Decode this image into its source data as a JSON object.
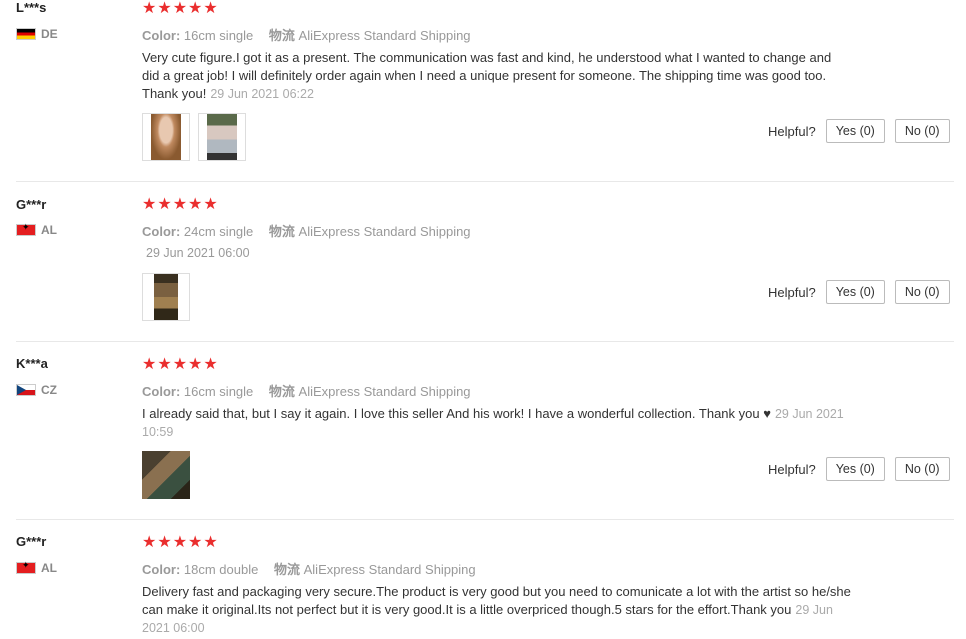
{
  "reviews": [
    {
      "user": "L***s",
      "country": "DE",
      "color_label": "Color:",
      "color_value": "16cm single",
      "ship_label": "物流",
      "ship_value": "AliExpress Standard Shipping",
      "text": "Very cute figure.I got it as a present. The communication was fast and kind, he understood what I wanted to change and did a great job! I will definitely order again when I need a unique present for someone. The shipping time was good too. Thank you!",
      "date": "29 Jun 2021 06:22",
      "rating": 5,
      "images": [
        "figure-photo",
        "figure-photo"
      ],
      "helpful_label": "Helpful?",
      "yes_label": "Yes (0)",
      "no_label": "No (0)"
    },
    {
      "user": "G***r",
      "country": "AL",
      "color_label": "Color:",
      "color_value": "24cm single",
      "ship_label": "物流",
      "ship_value": "AliExpress Standard Shipping",
      "text": "",
      "date": "29 Jun 2021 06:00",
      "rating": 5,
      "images": [
        "figure-photo"
      ],
      "helpful_label": "Helpful?",
      "yes_label": "Yes (0)",
      "no_label": "No (0)"
    },
    {
      "user": "K***a",
      "country": "CZ",
      "color_label": "Color:",
      "color_value": "16cm single",
      "ship_label": "物流",
      "ship_value": "AliExpress Standard Shipping",
      "text": "I already said that, but I say it again. I love this seller And his work! I have a wonderful collection. Thank you ♥",
      "date": "29 Jun 2021 10:59",
      "rating": 5,
      "images": [
        "collection-photo"
      ],
      "helpful_label": "Helpful?",
      "yes_label": "Yes (0)",
      "no_label": "No (0)"
    },
    {
      "user": "G***r",
      "country": "AL",
      "color_label": "Color:",
      "color_value": "18cm double",
      "ship_label": "物流",
      "ship_value": "AliExpress Standard Shipping",
      "text": "Delivery fast and packaging very secure.The product is very good but you need to comunicate a lot with the artist so he/she can make it original.Its not perfect but it is very good.It is a little overpriced though.5 stars for the effort.Thank you",
      "date": "29 Jun 2021 06:00",
      "rating": 5,
      "images": [],
      "helpful_label": "",
      "yes_label": "",
      "no_label": ""
    }
  ],
  "star_glyph": "★",
  "colors": {
    "star": "#ea2e2e",
    "muted": "#999999",
    "divider": "#e8e8e8"
  }
}
